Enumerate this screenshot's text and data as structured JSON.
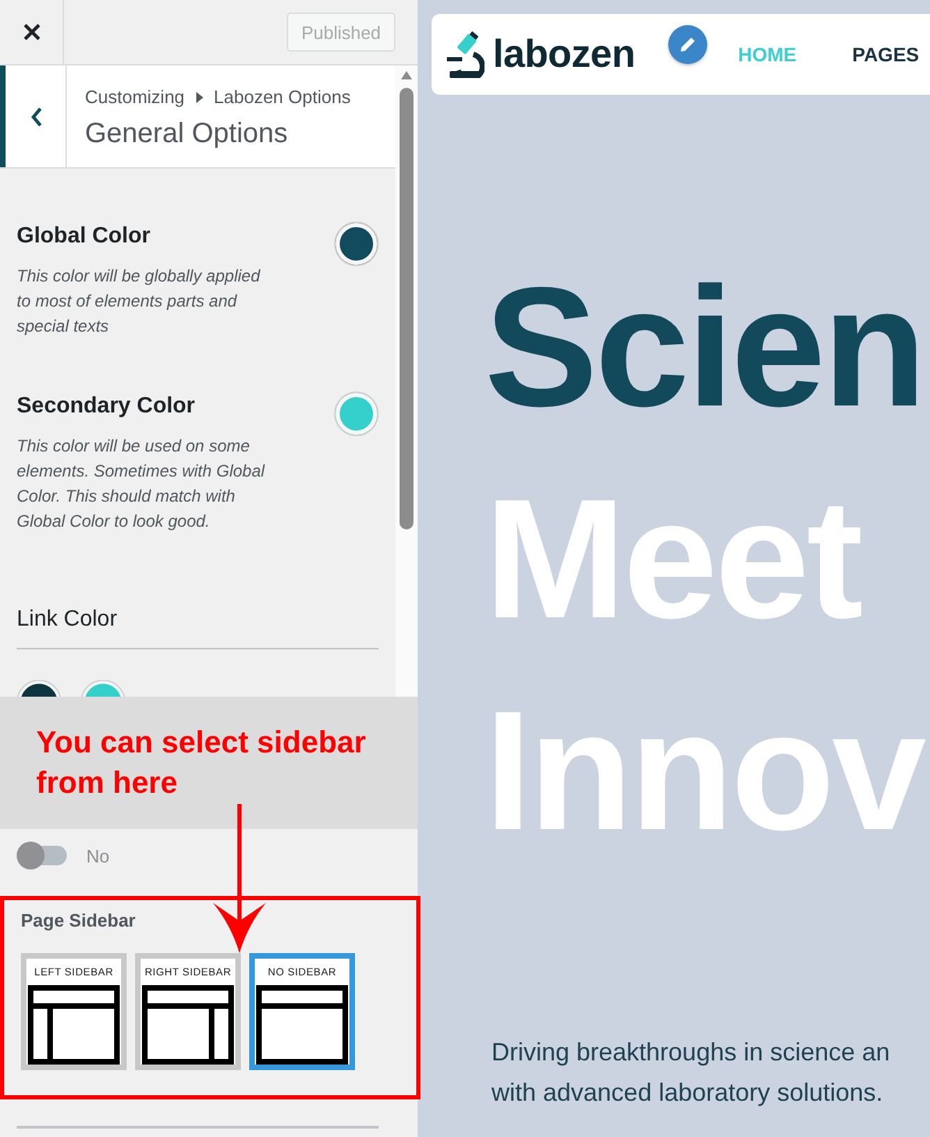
{
  "top_bar": {
    "publish_button": {
      "label": "Published",
      "disabled": true
    }
  },
  "header": {
    "breadcrumb": [
      "Customizing",
      "Labozen Options"
    ],
    "title": "General Options"
  },
  "sections": [
    {
      "kind": "color",
      "title": "Global Color",
      "description": "This color will be globally applied to most of elements parts and special texts",
      "color": "#134b5e"
    },
    {
      "kind": "color",
      "title": "Secondary Color",
      "description": "This color will be used on some elements. Sometimes with Global Color. This should match with Global Color to look good.",
      "color": "#35d0cb"
    },
    {
      "kind": "palette",
      "title": "Link Color",
      "swatches": [
        {
          "color": "#0e3440"
        },
        {
          "color": "#35d0cb"
        }
      ]
    }
  ],
  "annotation": {
    "text": "You can select sidebar from here"
  },
  "toggle": {
    "label": "No",
    "on": false
  },
  "page_sidebar": {
    "label": "Page Sidebar",
    "options": [
      {
        "label": "LEFT SIDEBAR",
        "kind": "left",
        "selected": false
      },
      {
        "label": "RIGHT SIDEBAR",
        "kind": "right",
        "selected": false
      },
      {
        "label": "NO SIDEBAR",
        "kind": "none",
        "selected": true
      }
    ]
  },
  "preview": {
    "logo": "labozen",
    "nav": [
      {
        "label": "HOME",
        "selected": true
      },
      {
        "label": "PAGES",
        "selected": false
      }
    ],
    "hero": [
      {
        "text": "Scien",
        "kind": "accent"
      },
      {
        "text": "Meet",
        "kind": "plain"
      },
      {
        "text": "Innov",
        "kind": "plain"
      }
    ],
    "intro": [
      "Driving breakthroughs in science an",
      "with advanced laboratory solutions."
    ]
  }
}
